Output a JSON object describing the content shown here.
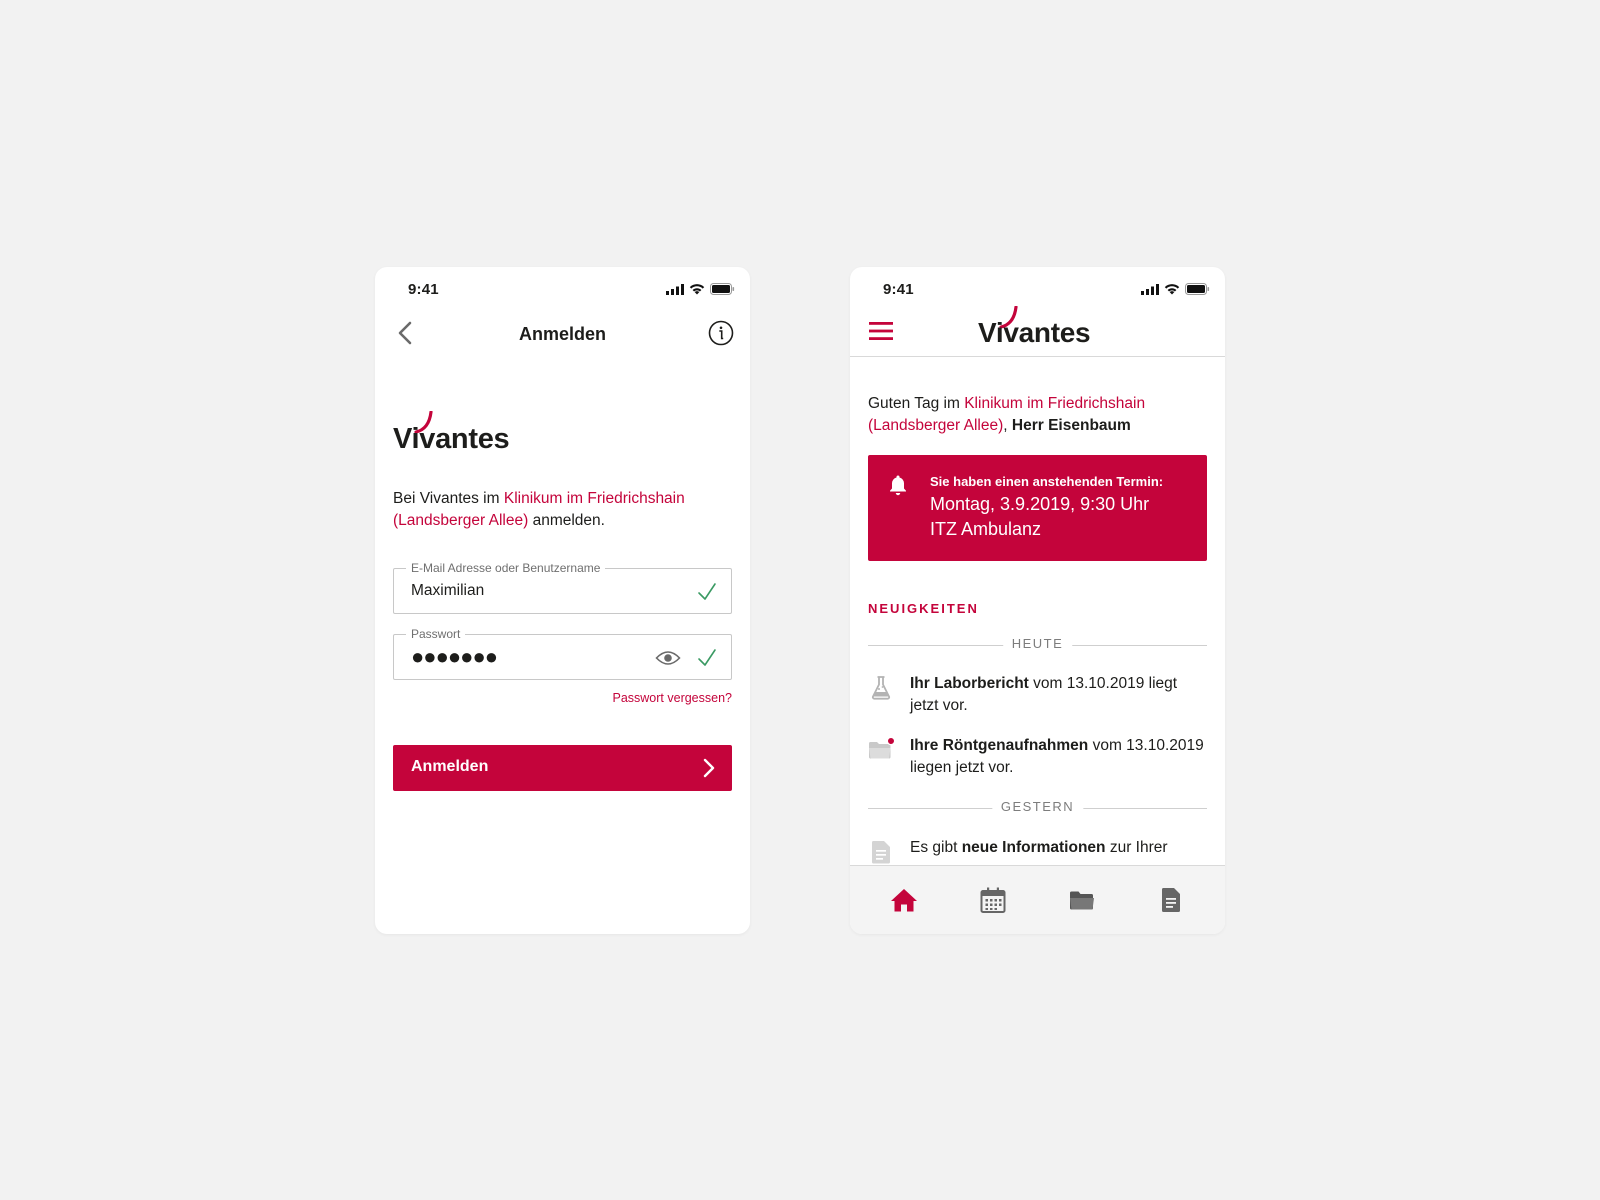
{
  "login": {
    "status_time": "9:41",
    "nav_title": "Anmelden",
    "logo_text": "Vivantes",
    "intro_prefix": "Bei Vivantes im ",
    "intro_link": "Klinikum im Friedrichshain (Landsberger Allee)",
    "intro_suffix": " anmelden.",
    "email_label": "E-Mail Adresse oder Benutzername",
    "email_value": "Maximilian",
    "password_label": "Passwort",
    "password_value": "●●●●●●●",
    "forgot_link": "Passwort vergessen?",
    "submit_label": "Anmelden"
  },
  "home": {
    "status_time": "9:41",
    "logo_text": "Vivantes",
    "greet_prefix": "Guten Tag im ",
    "greet_link": "Klinikum im Friedrichshain (Landsberger Allee)",
    "greet_sep": ", ",
    "greet_name": "Herr Eisenbaum",
    "alert_head": "Sie haben einen anstehenden Termin:",
    "alert_date": "Montag, 3.9.2019, 9:30 Uhr",
    "alert_place": "ITZ Ambulanz",
    "section_title": "NEUIGKEITEN",
    "divider_today": "HEUTE",
    "divider_yesterday": "GESTERN",
    "news": [
      {
        "bold": "Ihr Laborbericht",
        "rest": " vom 13.10.2019 liegt jetzt vor.",
        "icon": "lab-flask-icon"
      },
      {
        "bold": "Ihre Röntgenaufnahmen",
        "rest": " vom 13.10.2019 liegen jetzt vor.",
        "icon": "folder-icon"
      },
      {
        "pre": "Es gibt ",
        "bold": "neue Informationen",
        "rest": " zur Ihrer",
        "icon": "document-icon"
      }
    ],
    "tabs": [
      "home-icon",
      "calendar-icon",
      "folder-icon",
      "document-icon"
    ]
  },
  "colors": {
    "brand_red": "#c4043b",
    "check_green": "#3a9a63",
    "background": "#f2f2f2"
  }
}
